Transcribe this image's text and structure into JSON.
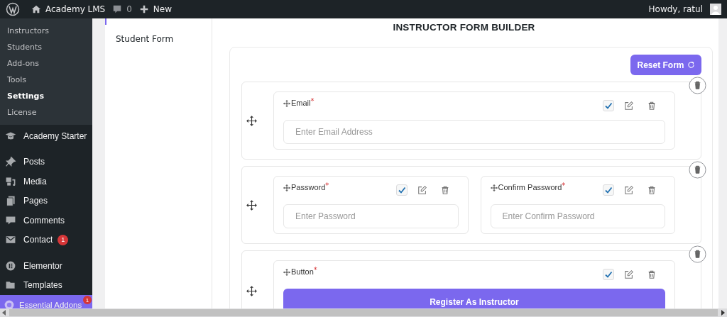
{
  "admin_bar": {
    "site_name": "Academy LMS",
    "comments_count": "0",
    "new_label": "New",
    "greeting": "Howdy, ratul"
  },
  "sidebar": {
    "submenu": [
      {
        "label": "Instructors",
        "selected": false
      },
      {
        "label": "Students",
        "selected": false
      },
      {
        "label": "Add-ons",
        "selected": false
      },
      {
        "label": "Tools",
        "selected": false
      },
      {
        "label": "Settings",
        "selected": true
      },
      {
        "label": "License",
        "selected": false
      }
    ],
    "items": [
      {
        "label": "Academy Starter",
        "selected": false
      },
      {
        "label": "Posts",
        "selected": false
      },
      {
        "label": "Media",
        "selected": false
      },
      {
        "label": "Pages",
        "selected": false
      },
      {
        "label": "Comments",
        "selected": false
      },
      {
        "label": "Contact",
        "selected": false,
        "badge": "1"
      },
      {
        "label": "Elementor",
        "selected": false
      },
      {
        "label": "Templates",
        "selected": false
      },
      {
        "label": "Essential Addons",
        "selected": true,
        "badge": "1"
      }
    ]
  },
  "form_tabs": [
    {
      "label": "Student Form"
    }
  ],
  "builder": {
    "title": "INSTRUCTOR FORM BUILDER",
    "reset_label": "Reset Form",
    "rows": [
      {
        "fields": [
          {
            "kind": "input",
            "label": "Email",
            "required_mark": "*",
            "checked": true,
            "placeholder": "Enter Email Address"
          }
        ]
      },
      {
        "fields": [
          {
            "kind": "input",
            "label": "Password",
            "required_mark": "*",
            "checked": true,
            "placeholder": "Enter Password"
          },
          {
            "kind": "input",
            "label": "Confirm Password",
            "required_mark": "*",
            "checked": true,
            "placeholder": "Enter Confirm Password"
          }
        ]
      },
      {
        "fields": [
          {
            "kind": "button",
            "label": "Button",
            "required_mark": "*",
            "checked": true,
            "button_text": "Register As Instructor"
          }
        ]
      }
    ]
  }
}
